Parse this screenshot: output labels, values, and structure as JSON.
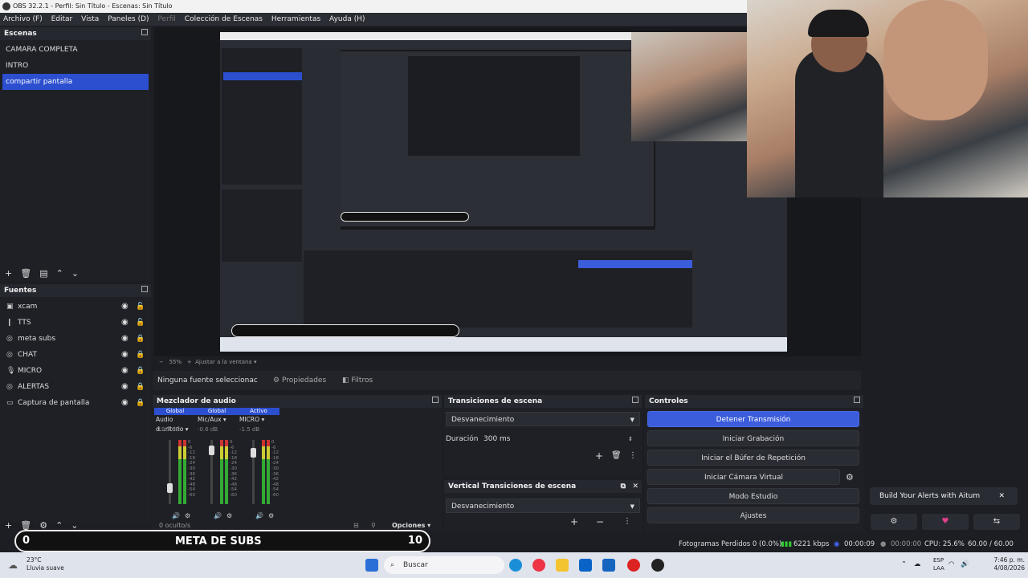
{
  "window": {
    "title": "OBS 32.2.1 - Perfil: Sin Título - Escenas: Sin Título"
  },
  "menu": [
    "Archivo (F)",
    "Editar",
    "Vista",
    "Paneles (D)",
    "Perfil",
    "Colección de Escenas",
    "Herramientas",
    "Ayuda (H)"
  ],
  "scenes": {
    "title": "Escenas",
    "items": [
      "CAMARA COMPLETA",
      "INTRO",
      "compartir pantalla"
    ],
    "selected": "compartir pantalla"
  },
  "sources": {
    "title": "Fuentes",
    "items": [
      "xcam",
      "TTS",
      "meta subs",
      "CHAT",
      "MICRO",
      "ALERTAS",
      "Captura de pantalla"
    ]
  },
  "zoom": {
    "value": "55%",
    "fit_label": "Ajustar a la ventana"
  },
  "context": {
    "no_source": "Ninguna fuente seleccionac",
    "properties": "Propiedades",
    "filters": "Filtros"
  },
  "mixer": {
    "title": "Mezclador de audio",
    "channels": [
      {
        "badge": "Global",
        "name": "Audio d...ritorio",
        "db": "-19.5 dB",
        "level": 0.2
      },
      {
        "badge": "Global",
        "name": "Mic/Aux",
        "db": "-0.6 dB",
        "level": 0.9
      },
      {
        "badge": "Activo",
        "name": "MICRO",
        "db": "-1.5 dB",
        "level": 0.85
      }
    ],
    "scale": [
      "0",
      "-6",
      "-12",
      "-18",
      "-24",
      "-30",
      "-36",
      "-42",
      "-48",
      "-54",
      "-60"
    ],
    "hidden": "0 oculto/s",
    "options": "Opciones"
  },
  "transitions": {
    "title": "Transiciones de escena",
    "selected": "Desvanecimiento",
    "duration_label": "Duración",
    "duration": "300 ms"
  },
  "vtransitions": {
    "title": "Vertical Transiciones de escena",
    "selected": "Desvanecimiento"
  },
  "controls": {
    "title": "Controles",
    "buttons": [
      "Detener Transmisión",
      "Iniciar Grabación",
      "Iniciar el Búfer de Repetición",
      "Iniciar Cámara Virtual",
      "Modo Estudio",
      "Ajustes"
    ]
  },
  "aitum": {
    "label": "Build Your Alerts with Aitum"
  },
  "status": {
    "dropped": "Fotogramas Perdidos 0 (0.0%)",
    "bitrate": "6221 kbps",
    "stream_time": "00:00:09",
    "rec_time": "00:00:00",
    "cpu": "CPU: 25.6%",
    "fps": "60.00 / 60.00 FPS"
  },
  "meta": {
    "left": "0",
    "label": "META DE SUBS",
    "right": "10"
  },
  "taskbar": {
    "temp": "23°C",
    "weather": "Lluvia suave",
    "search": "Buscar",
    "lang": "ESP",
    "lang2": "LAA",
    "time": "7:46 p. m.",
    "date": "4/08/2026"
  },
  "colors": {
    "accent": "#3b5cdb",
    "selection": "#2c4fd0",
    "panel": "#1f2026"
  }
}
